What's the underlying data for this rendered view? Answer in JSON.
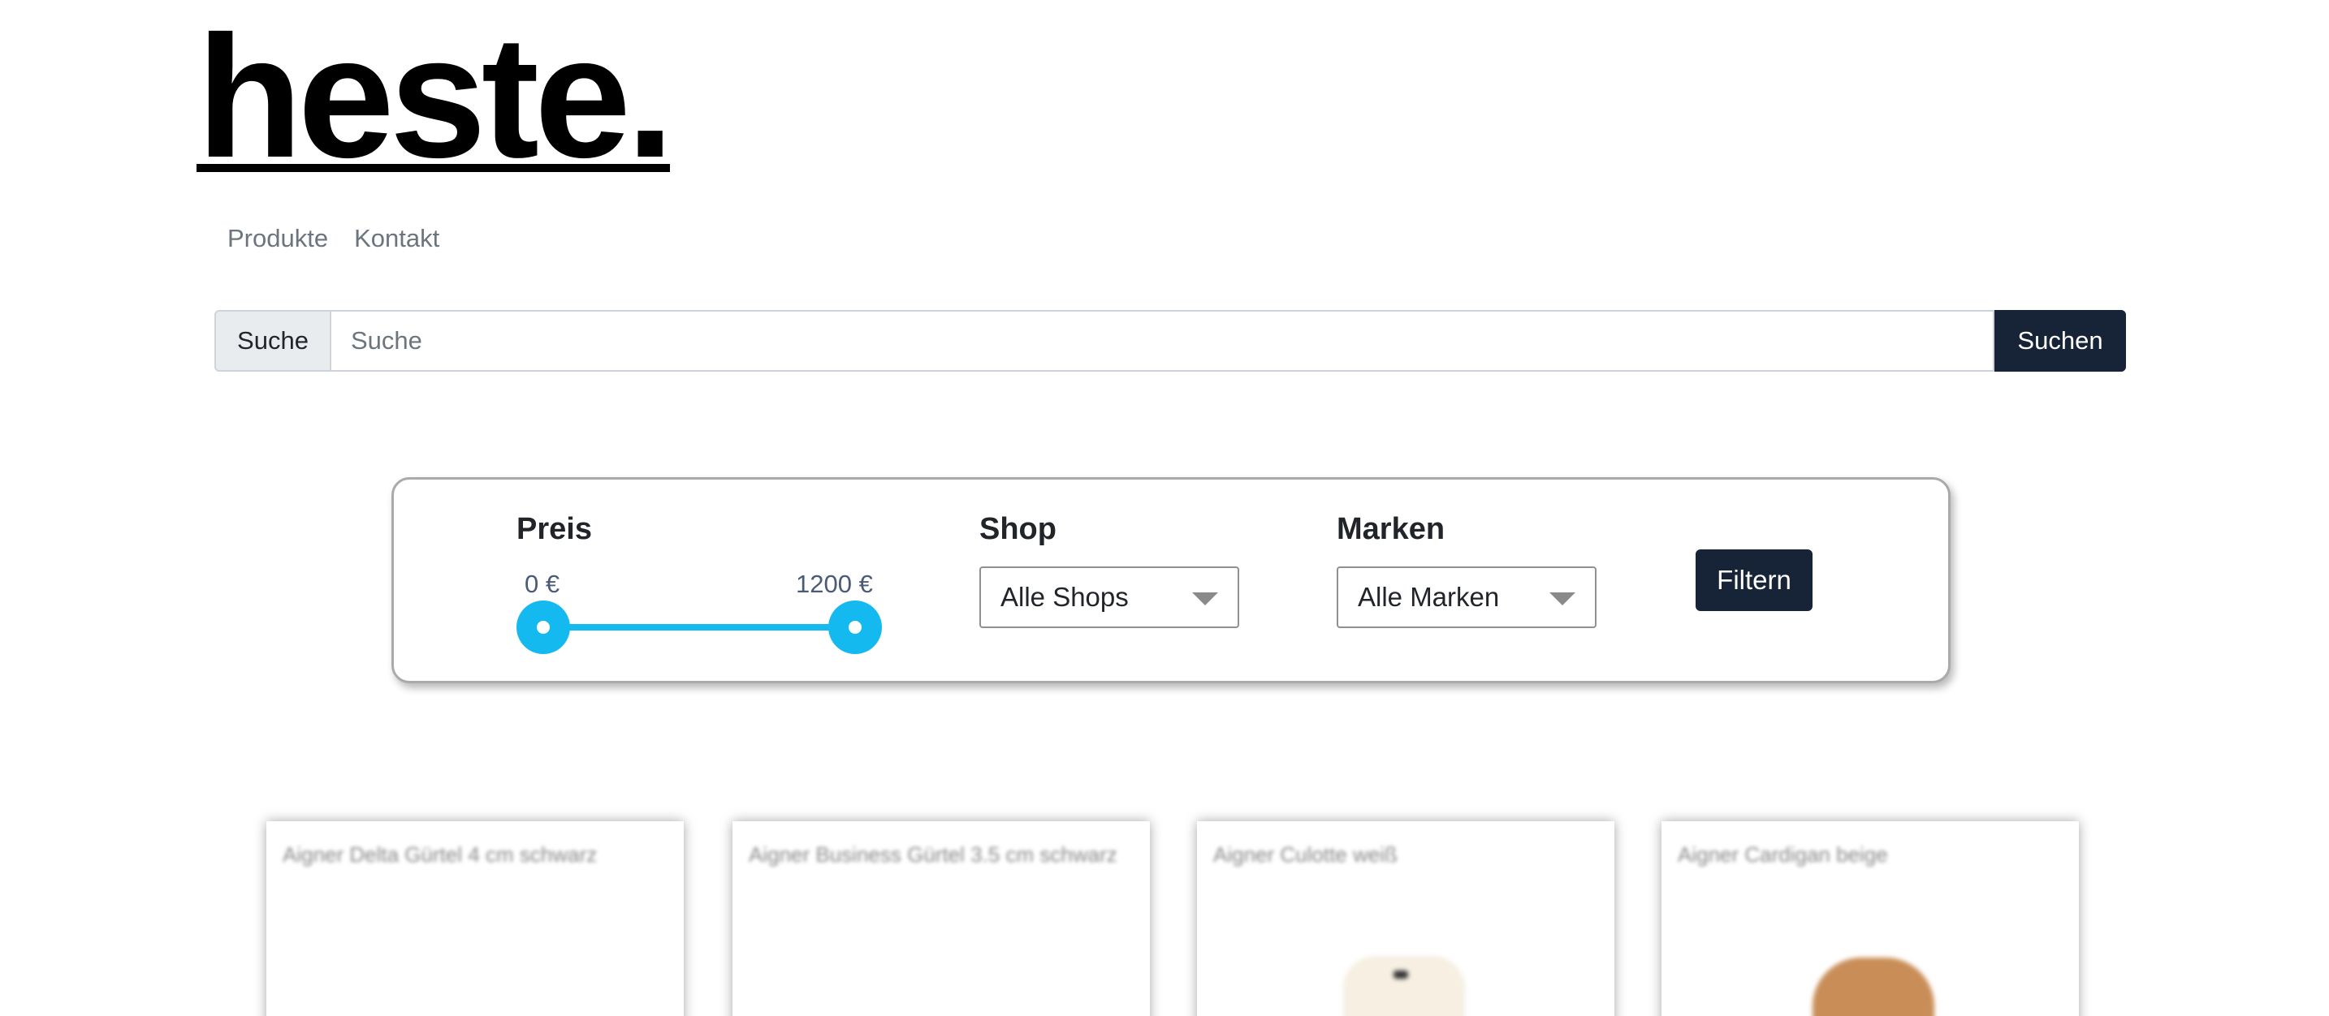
{
  "logo": {
    "text": "heste."
  },
  "nav": {
    "items": [
      "Produkte",
      "Kontakt"
    ]
  },
  "search": {
    "label": "Suche",
    "placeholder": "Suche",
    "value": "",
    "button": "Suchen"
  },
  "filter": {
    "price": {
      "title": "Preis",
      "min_label": "0 €",
      "max_label": "1200 €",
      "min": 0,
      "max": 1200
    },
    "shop": {
      "title": "Shop",
      "selected": "Alle Shops"
    },
    "brands": {
      "title": "Marken",
      "selected": "Alle Marken"
    },
    "button": "Filtern",
    "accent_color": "#14b9f0"
  },
  "products": [
    {
      "title": "Aigner Delta Gürtel 4 cm schwarz"
    },
    {
      "title": "Aigner Business Gürtel 3.5 cm schwarz"
    },
    {
      "title": "Aigner Culotte weiß"
    },
    {
      "title": "Aigner Cardigan beige"
    }
  ]
}
